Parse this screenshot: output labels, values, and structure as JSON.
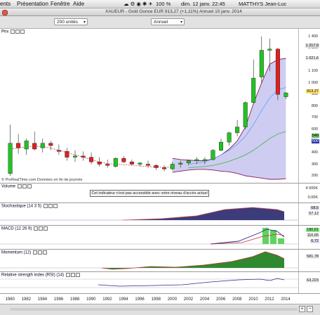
{
  "menubar": {
    "items": [
      "ents",
      "Présentation",
      "Fenêtre",
      "Aide"
    ],
    "battery": "100 %",
    "datetime": "dim. 12 janv.  22:45",
    "user": "MATTHYS Jean-Luc"
  },
  "window": {
    "title": "XAUEUR - Gold Ounce EUR   913,27 (+1,11%)   Annuel   10 janv. 2014"
  },
  "toolbar": {
    "units_value": "200 unités",
    "period_value": "Annuel"
  },
  "price_panel": {
    "label": "Prix",
    "watermark": "© ProRealTime.com   Données en fin de journée",
    "scale_ticks": [
      "1 400",
      "1 300",
      "1 100",
      "1 000",
      "900",
      "800",
      "700",
      "600",
      "500",
      "400",
      "300",
      "200"
    ],
    "tags": {
      "upper": "1 217,9",
      "mid": "1 021,6",
      "last": "913,27",
      "low1": "540",
      "low2": "500"
    },
    "colors": {
      "up": "#23c223",
      "down": "#e02020",
      "band_fill": "#c6c4ee",
      "band_line": "#8b1a5a",
      "ma_blue": "#6aa6ff",
      "ma_green": "#55b455",
      "ma_dash": "#c03030"
    }
  },
  "volume_panel": {
    "label": "Volume",
    "notice": "Cet indicateur n'est pas accessible avec votre niveau d'accès actuel",
    "scale_ticks": [
      "4 000K",
      "0,00K"
    ]
  },
  "stoch_panel": {
    "label": "Stochastique (14 3 5)",
    "tags": [
      "68,5",
      "57,12"
    ]
  },
  "macd_panel": {
    "label": "MACD (12 26 9)",
    "tags": [
      "180,61",
      "110,65",
      "6,72"
    ]
  },
  "momentum_panel": {
    "label": "Momentum (12)",
    "tags": [
      "581,78"
    ]
  },
  "rsi_panel": {
    "label": "Relative strength index (RSI) (14)",
    "tags": [
      "63,223"
    ]
  },
  "xaxis": {
    "labels": [
      "1980",
      "1982",
      "1984",
      "1986",
      "1988",
      "1990",
      "1992",
      "1994",
      "1996",
      "1998",
      "2000",
      "2002",
      "2004",
      "2006",
      "2008",
      "2010",
      "2012",
      "2014"
    ]
  },
  "chart_data": {
    "type": "candlestick",
    "title": "XAUEUR - Gold Ounce EUR",
    "period": "Annuel",
    "years": [
      1980,
      1981,
      1982,
      1983,
      1984,
      1985,
      1986,
      1987,
      1988,
      1989,
      1990,
      1991,
      1992,
      1993,
      1994,
      1995,
      1996,
      1997,
      1998,
      1999,
      2000,
      2001,
      2002,
      2003,
      2004,
      2005,
      2006,
      2007,
      2008,
      2009,
      2010,
      2011,
      2012,
      2013,
      2014
    ],
    "candles": [
      {
        "o": 220,
        "h": 640,
        "l": 200,
        "c": 480
      },
      {
        "o": 480,
        "h": 560,
        "l": 390,
        "c": 440
      },
      {
        "o": 430,
        "h": 520,
        "l": 380,
        "c": 500
      },
      {
        "o": 480,
        "h": 580,
        "l": 420,
        "c": 430
      },
      {
        "o": 440,
        "h": 520,
        "l": 400,
        "c": 480
      },
      {
        "o": 480,
        "h": 500,
        "l": 420,
        "c": 460
      },
      {
        "o": 420,
        "h": 470,
        "l": 380,
        "c": 410
      },
      {
        "o": 410,
        "h": 440,
        "l": 330,
        "c": 360
      },
      {
        "o": 360,
        "h": 420,
        "l": 320,
        "c": 370
      },
      {
        "o": 370,
        "h": 410,
        "l": 330,
        "c": 360
      },
      {
        "o": 360,
        "h": 400,
        "l": 300,
        "c": 320
      },
      {
        "o": 320,
        "h": 360,
        "l": 280,
        "c": 300
      },
      {
        "o": 300,
        "h": 340,
        "l": 270,
        "c": 290
      },
      {
        "o": 280,
        "h": 360,
        "l": 270,
        "c": 350
      },
      {
        "o": 350,
        "h": 370,
        "l": 310,
        "c": 320
      },
      {
        "o": 320,
        "h": 340,
        "l": 290,
        "c": 300
      },
      {
        "o": 300,
        "h": 320,
        "l": 280,
        "c": 310
      },
      {
        "o": 300,
        "h": 330,
        "l": 270,
        "c": 290
      },
      {
        "o": 290,
        "h": 300,
        "l": 250,
        "c": 270
      },
      {
        "o": 270,
        "h": 290,
        "l": 240,
        "c": 260
      },
      {
        "o": 260,
        "h": 320,
        "l": 250,
        "c": 300
      },
      {
        "o": 300,
        "h": 330,
        "l": 270,
        "c": 310
      },
      {
        "o": 310,
        "h": 340,
        "l": 290,
        "c": 330
      },
      {
        "o": 330,
        "h": 360,
        "l": 300,
        "c": 340
      },
      {
        "o": 330,
        "h": 360,
        "l": 300,
        "c": 340
      },
      {
        "o": 340,
        "h": 430,
        "l": 330,
        "c": 420
      },
      {
        "o": 420,
        "h": 520,
        "l": 410,
        "c": 490
      },
      {
        "o": 490,
        "h": 580,
        "l": 460,
        "c": 570
      },
      {
        "o": 570,
        "h": 680,
        "l": 540,
        "c": 620
      },
      {
        "o": 620,
        "h": 840,
        "l": 600,
        "c": 830
      },
      {
        "o": 830,
        "h": 1200,
        "l": 820,
        "c": 1040
      },
      {
        "o": 1050,
        "h": 1400,
        "l": 1000,
        "c": 1280
      },
      {
        "o": 1280,
        "h": 1380,
        "l": 1100,
        "c": 1290
      },
      {
        "o": 1290,
        "h": 1300,
        "l": 850,
        "c": 900
      },
      {
        "o": 880,
        "h": 920,
        "l": 860,
        "c": 913
      }
    ],
    "yrange": [
      170,
      1440
    ],
    "xrange": [
      1979,
      2015
    ]
  }
}
